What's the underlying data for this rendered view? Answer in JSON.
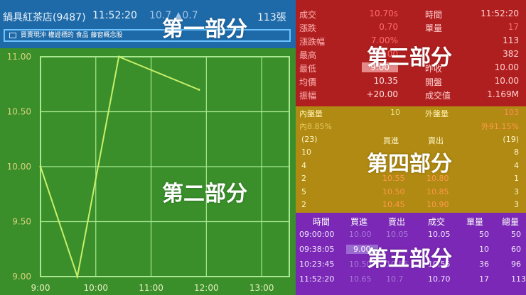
{
  "header": {
    "title": "鍋具紅茶店(9487)",
    "time": "11:52:20",
    "change_partial": "10.7 ▲0.7",
    "volume": "113張",
    "tags": "買賣現沖  權證標的  食品  藤窗概念股",
    "tags_icon": "list-icon"
  },
  "labels": {
    "part1": "第一部分",
    "part2": "第二部分",
    "part3": "第三部分",
    "part4": "第四部分",
    "part5": "第五部分"
  },
  "quote": {
    "rows": [
      {
        "l1": "成交",
        "v1": "10.70s",
        "l2": "時間",
        "v2": "11:52:20"
      },
      {
        "l1": "漲跌",
        "v1": "0.70",
        "l2": "單量",
        "v2": "17"
      },
      {
        "l1": "漲跌幅",
        "v1": "7.00%",
        "l2": "",
        "v2": "113"
      },
      {
        "l1": "最高",
        "v1": "11.00",
        "l2": "",
        "v2": "382"
      },
      {
        "l1": "最低",
        "v1": "9.00",
        "l2": "昨收",
        "v2": "10.00"
      },
      {
        "l1": "均價",
        "v1": "10.35",
        "l2": "開盤",
        "v2": "10.00"
      },
      {
        "l1": "振幅",
        "v1": "+20.00",
        "l2": "成交值",
        "v2": "1.169M"
      }
    ]
  },
  "book": {
    "inner_label": "內盤量",
    "inner_value": "10",
    "outer_label": "外盤量",
    "outer_value": "103",
    "inner_pct": "內8.85%",
    "outer_pct": "外91.15%",
    "bid_total": "(23)",
    "bid_label": "買進",
    "ask_label": "賣出",
    "ask_total": "(19)",
    "levels": [
      {
        "bq": "10",
        "bp": "",
        "ap": "",
        "aq": "8"
      },
      {
        "bq": "4",
        "bp": "",
        "ap": "",
        "aq": "4"
      },
      {
        "bq": "2",
        "bp": "10.55",
        "ap": "10.80",
        "aq": "1"
      },
      {
        "bq": "5",
        "bp": "10.50",
        "ap": "10.85",
        "aq": "3"
      },
      {
        "bq": "2",
        "bp": "10.45",
        "ap": "10.90",
        "aq": "3"
      }
    ]
  },
  "trades": {
    "headers": [
      "時間",
      "買進",
      "賣出",
      "成交",
      "單量",
      "總量"
    ],
    "rows": [
      [
        "09:00:00",
        "10.00",
        "10.05",
        "10.05",
        "50",
        "50"
      ],
      [
        "09:38:05",
        "9.00",
        "",
        "",
        "10",
        "60"
      ],
      [
        "10:23:45",
        "10.50",
        "10.55",
        "10.55",
        "36",
        "96"
      ],
      [
        "11:52:20",
        "10.65",
        "10.7",
        "10.70",
        "17",
        "113"
      ]
    ]
  },
  "chart_data": {
    "type": "line",
    "x": [
      "9:00",
      "9:40",
      "10:25",
      "11:52"
    ],
    "y": [
      10.0,
      9.0,
      11.0,
      10.7
    ],
    "xticks": [
      "9:00",
      "10:00",
      "11:00",
      "12:00",
      "13:00"
    ],
    "yticks": [
      "11.00",
      "10.50",
      "10.00",
      "9.50",
      "9.00"
    ],
    "ylim": [
      9.0,
      11.0
    ],
    "xlim": [
      "9:00",
      "13:30"
    ],
    "grid": true,
    "line_color": "#c8f06a",
    "grid_color": "#a8e890"
  }
}
